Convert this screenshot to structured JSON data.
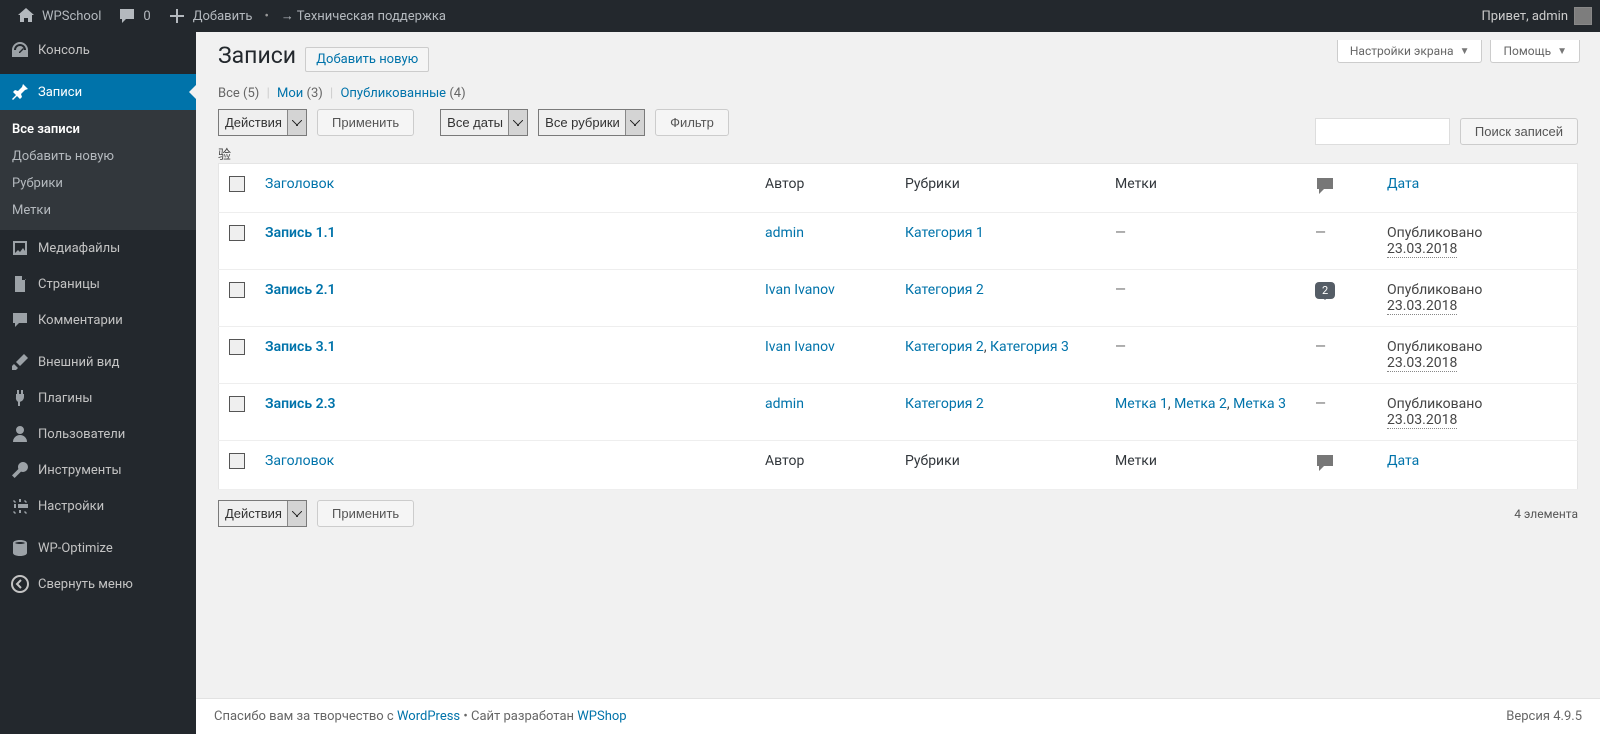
{
  "adminbar": {
    "site_name": "WPSchool",
    "comments_count": "0",
    "new": "Добавить",
    "support": "→ Техническая поддержка",
    "howdy": "Привет, admin"
  },
  "sidebar": {
    "dashboard": "Консоль",
    "posts": "Записи",
    "posts_sub": {
      "all": "Все записи",
      "new": "Добавить новую",
      "cats": "Рубрики",
      "tags": "Метки"
    },
    "media": "Медиафайлы",
    "pages": "Страницы",
    "comments": "Комментарии",
    "appearance": "Внешний вид",
    "plugins": "Плагины",
    "users": "Пользователи",
    "tools": "Инструменты",
    "settings": "Настройки",
    "wpoptimize": "WP-Optimize",
    "collapse": "Свернуть меню"
  },
  "screen_opts": "Настройки экрана",
  "help": "Помощь",
  "page_title": "Записи",
  "add_new": "Добавить новую",
  "filters": {
    "all": "Все",
    "all_count": "(5)",
    "mine": "Мои",
    "mine_count": "(3)",
    "published": "Опубликованные",
    "published_count": "(4)"
  },
  "search_btn": "Поиск записей",
  "bulk_actions": "Действия",
  "apply": "Применить",
  "dates": "Все даты",
  "cats_filter": "Все рубрики",
  "filter_btn": "Фильтр",
  "items_count": "4 элемента",
  "cols": {
    "title": "Заголовок",
    "author": "Автор",
    "cats": "Рубрики",
    "tags": "Метки",
    "date": "Дата"
  },
  "rows": [
    {
      "title": "Запись 1.1",
      "author": "admin",
      "cats": "Категория 1",
      "tags": "—",
      "comments": "—",
      "status": "Опубликовано",
      "date": "23.03.2018"
    },
    {
      "title": "Запись 2.1",
      "author": "Ivan Ivanov",
      "cats": "Категория 2",
      "tags": "—",
      "comments": "2",
      "status": "Опубликовано",
      "date": "23.03.2018"
    },
    {
      "title": "Запись 3.1",
      "author": "Ivan Ivanov",
      "cats": "Категория 2, Категория 3",
      "tags": "—",
      "comments": "—",
      "status": "Опубликовано",
      "date": "23.03.2018"
    },
    {
      "title": "Запись 2.3",
      "author": "admin",
      "cats": "Категория 2",
      "tags": "Метка 1, Метка 2, Метка 3",
      "comments": "—",
      "status": "Опубликовано",
      "date": "23.03.2018"
    }
  ],
  "footer": {
    "thanks_pre": "Спасибо вам за творчество с ",
    "wp": "WordPress",
    "dev_pre": " • Сайт разработан ",
    "wpshop": "WPShop",
    "version": "Версия 4.9.5"
  }
}
